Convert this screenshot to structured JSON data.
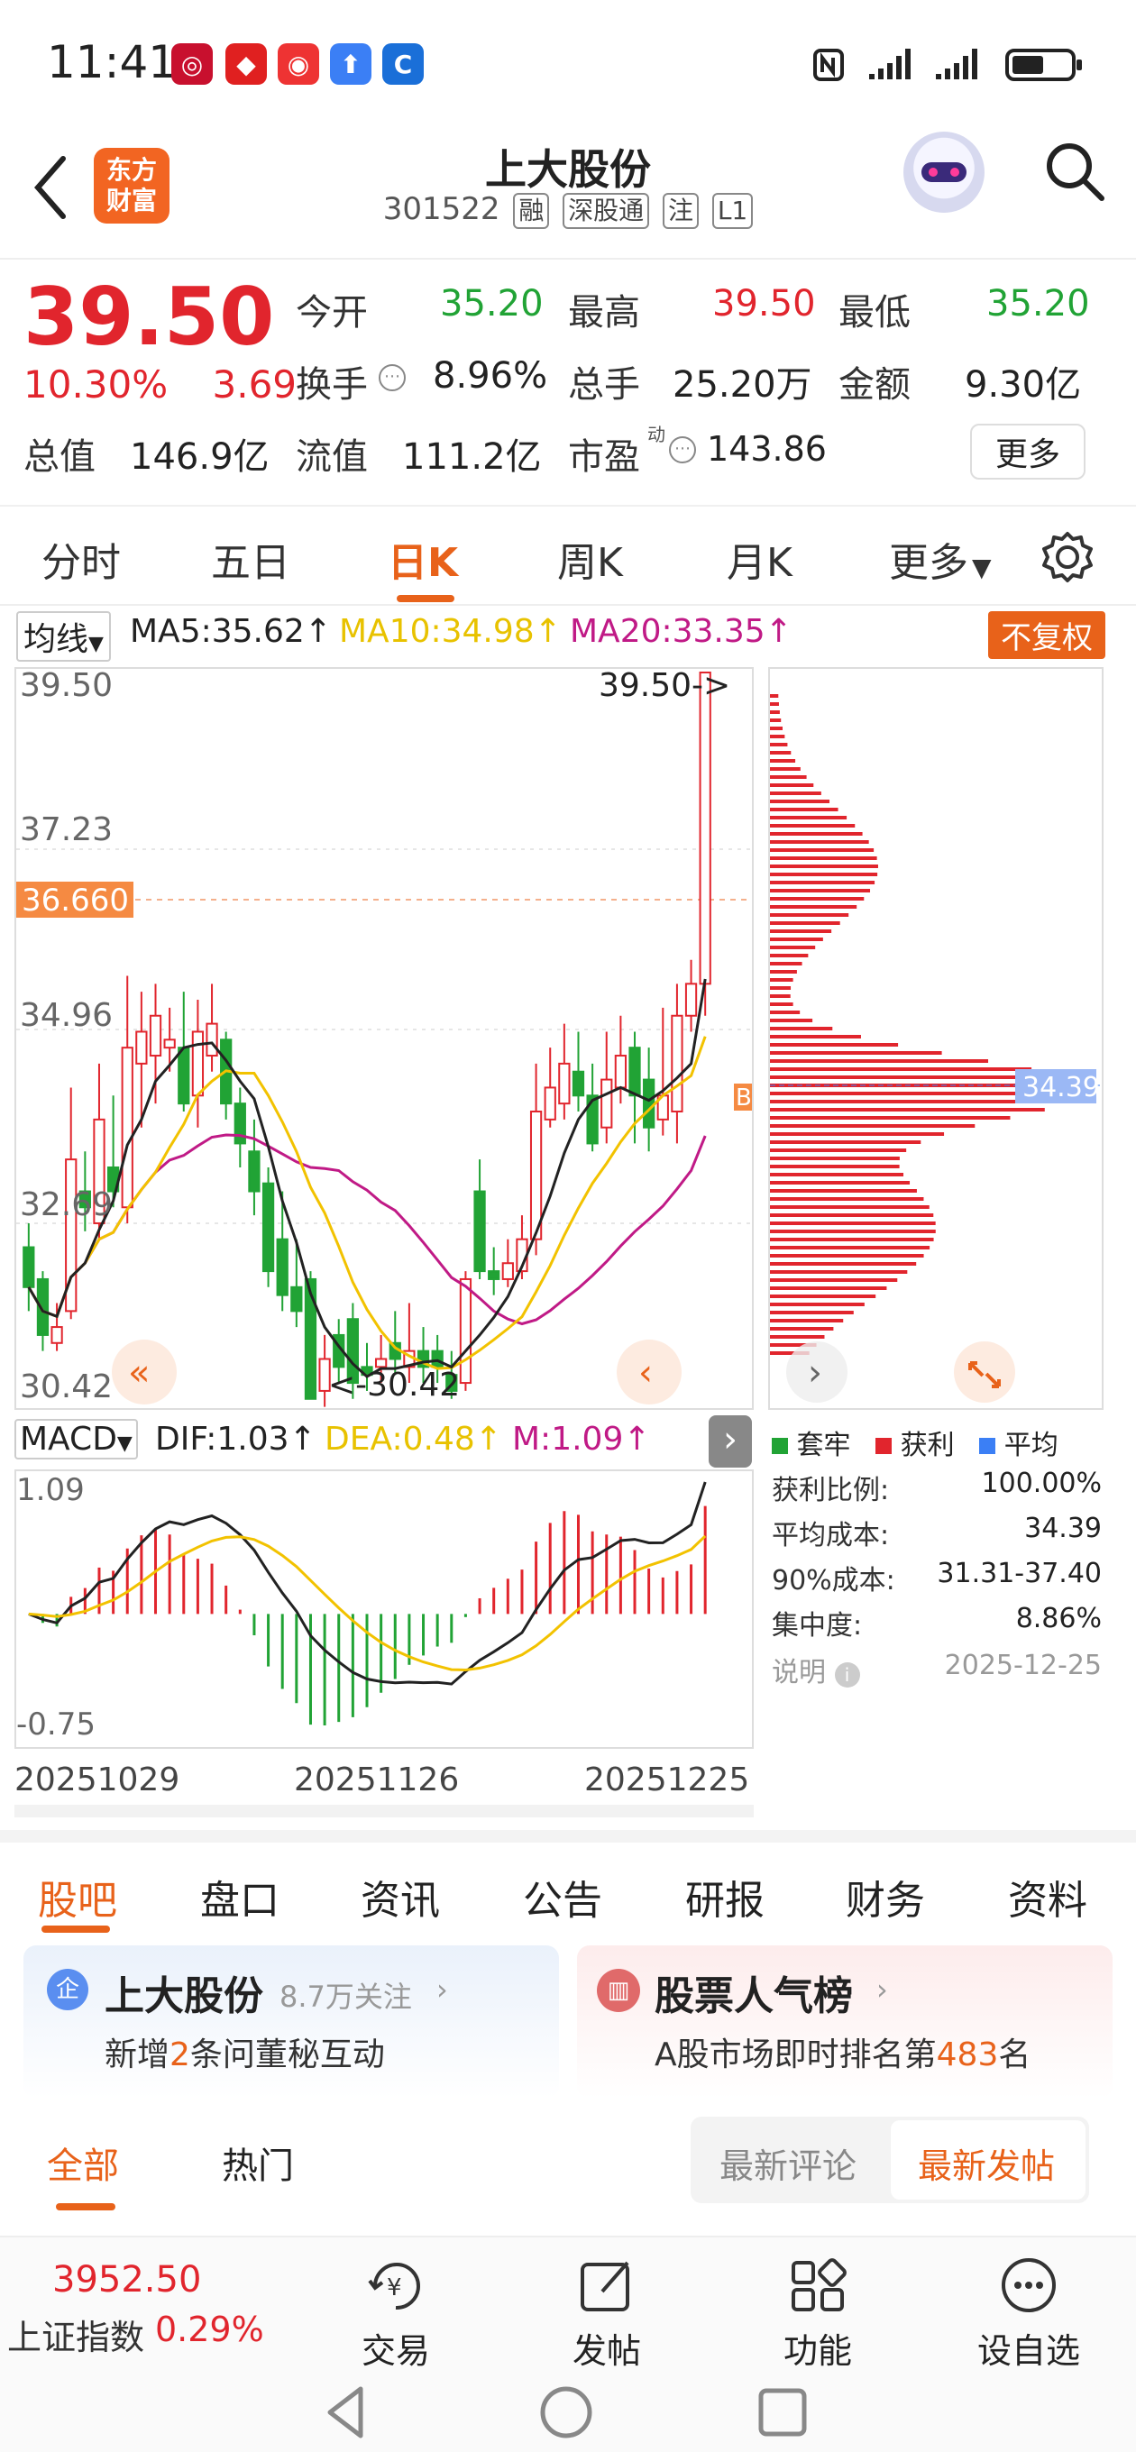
{
  "status": {
    "time": "11:41"
  },
  "header": {
    "title": "上大股份",
    "code": "301522",
    "tags": [
      "融",
      "深股通",
      "注",
      "L1"
    ],
    "logo_line1": "东方",
    "logo_line2": "财富"
  },
  "quote": {
    "price": "39.50",
    "change_pct": "10.30%",
    "change": "3.69",
    "open_label": "今开",
    "open": "35.20",
    "high_label": "最高",
    "high": "39.50",
    "low_label": "最低",
    "low": "35.20",
    "turnover_label": "换手",
    "turnover": "8.96%",
    "volume_label": "总手",
    "volume": "25.20万",
    "amount_label": "金额",
    "amount": "9.30亿",
    "mktcap_label": "总值",
    "mktcap": "146.9亿",
    "float_label": "流值",
    "float": "111.2亿",
    "pe_label": "市盈",
    "pe_sup": "动",
    "pe": "143.86",
    "more": "更多"
  },
  "tabs": [
    "分时",
    "五日",
    "日K",
    "周K",
    "月K",
    "更多"
  ],
  "ma": {
    "label": "均线",
    "ma5": "MA5:35.62↑",
    "ma10": "MA10:34.98↑",
    "ma20": "MA20:33.35↑",
    "fq": "不复权"
  },
  "kline": {
    "y_labels": [
      "39.50",
      "37.23",
      "34.96",
      "32.69",
      "30.42"
    ],
    "current_price_tag": "36.660",
    "max_tag": "39.50->",
    "min_tag": "<-30.42",
    "b_tag": "B"
  },
  "chip": {
    "avg_tag": "34.39"
  },
  "macd": {
    "label": "MACD",
    "dif": "DIF:1.03↑",
    "dea": "DEA:0.48↑",
    "m": "M:1.09↑",
    "top": "1.09",
    "bottom": "-0.75"
  },
  "dates": [
    "20251029",
    "20251126",
    "20251225"
  ],
  "chip_stats": {
    "legend": [
      "套牢",
      "获利",
      "平均"
    ],
    "rows": [
      {
        "label": "获利比例:",
        "value": "100.00%"
      },
      {
        "label": "平均成本:",
        "value": "34.39"
      },
      {
        "label": "90%成本:",
        "value": "31.31-37.40"
      },
      {
        "label": "集中度:",
        "value": "8.86%"
      }
    ],
    "note_label": "说明",
    "note_date": "2025-12-25"
  },
  "bottom_tabs": [
    "股吧",
    "盘口",
    "资讯",
    "公告",
    "研报",
    "财务",
    "资料"
  ],
  "card_left": {
    "badge": "企",
    "title": "上大股份",
    "follow": "8.7万关注",
    "line_pre": "新增",
    "line_num": "2",
    "line_post": "条问董秘互动"
  },
  "card_right": {
    "title": "股票人气榜",
    "line_pre": "A股市场即时排名第",
    "line_num": "483",
    "line_post": "名"
  },
  "sub_tabs": [
    "全部",
    "热门"
  ],
  "sort": [
    "最新评论",
    "最新发帖"
  ],
  "index": {
    "value": "3952.50",
    "name": "上证指数",
    "pct": "0.29%"
  },
  "nav": [
    "交易",
    "发帖",
    "功能",
    "设自选"
  ],
  "colors": {
    "up": "#e1252d",
    "down": "#21a335",
    "accent": "#e8621a",
    "ma5": "#222222",
    "ma10": "#f2c200",
    "ma20": "#c01a86"
  },
  "chart_data": {
    "type": "candlestick",
    "ylim": [
      30.42,
      39.5
    ],
    "candles": [
      {
        "o": 32.3,
        "c": 31.8,
        "h": 32.6,
        "l": 31.5
      },
      {
        "o": 31.9,
        "c": 31.2,
        "h": 32.0,
        "l": 31.0
      },
      {
        "o": 31.1,
        "c": 31.3,
        "h": 31.6,
        "l": 31.0
      },
      {
        "o": 31.5,
        "c": 33.4,
        "h": 34.3,
        "l": 31.4
      },
      {
        "o": 33.0,
        "c": 32.8,
        "h": 33.5,
        "l": 32.5
      },
      {
        "o": 32.6,
        "c": 33.9,
        "h": 34.6,
        "l": 32.4
      },
      {
        "o": 33.3,
        "c": 33.0,
        "h": 34.2,
        "l": 32.8
      },
      {
        "o": 32.8,
        "c": 34.8,
        "h": 35.7,
        "l": 32.6
      },
      {
        "o": 34.6,
        "c": 35.0,
        "h": 35.5,
        "l": 33.8
      },
      {
        "o": 34.7,
        "c": 35.2,
        "h": 35.6,
        "l": 34.1
      },
      {
        "o": 34.8,
        "c": 34.9,
        "h": 35.3,
        "l": 34.5
      },
      {
        "o": 34.8,
        "c": 34.1,
        "h": 35.5,
        "l": 34.0
      },
      {
        "o": 34.2,
        "c": 35.0,
        "h": 35.4,
        "l": 33.8
      },
      {
        "o": 34.7,
        "c": 35.1,
        "h": 35.6,
        "l": 34.5
      },
      {
        "o": 34.9,
        "c": 34.1,
        "h": 35.0,
        "l": 33.9
      },
      {
        "o": 34.1,
        "c": 33.6,
        "h": 34.3,
        "l": 33.3
      },
      {
        "o": 33.5,
        "c": 33.0,
        "h": 33.9,
        "l": 32.7
      },
      {
        "o": 33.1,
        "c": 32.0,
        "h": 33.3,
        "l": 31.8
      },
      {
        "o": 32.4,
        "c": 31.7,
        "h": 33.0,
        "l": 31.5
      },
      {
        "o": 31.8,
        "c": 31.5,
        "h": 32.4,
        "l": 31.3
      },
      {
        "o": 31.9,
        "c": 30.4,
        "h": 32.0,
        "l": 30.42
      },
      {
        "o": 30.5,
        "c": 30.9,
        "h": 31.2,
        "l": 30.3
      },
      {
        "o": 31.2,
        "c": 30.8,
        "h": 31.4,
        "l": 30.6
      },
      {
        "o": 31.4,
        "c": 30.6,
        "h": 31.6,
        "l": 30.4
      },
      {
        "o": 30.8,
        "c": 30.7,
        "h": 31.1,
        "l": 30.5
      },
      {
        "o": 30.8,
        "c": 30.9,
        "h": 31.2,
        "l": 30.6
      },
      {
        "o": 31.1,
        "c": 30.9,
        "h": 31.5,
        "l": 30.7
      },
      {
        "o": 30.8,
        "c": 31.0,
        "h": 31.6,
        "l": 30.6
      },
      {
        "o": 31.0,
        "c": 30.8,
        "h": 31.3,
        "l": 30.6
      },
      {
        "o": 31.0,
        "c": 30.8,
        "h": 31.2,
        "l": 30.6
      },
      {
        "o": 30.7,
        "c": 30.5,
        "h": 31.0,
        "l": 30.4
      },
      {
        "o": 30.6,
        "c": 31.9,
        "h": 32.0,
        "l": 30.5
      },
      {
        "o": 33.0,
        "c": 32.0,
        "h": 33.4,
        "l": 31.9
      },
      {
        "o": 32.0,
        "c": 31.9,
        "h": 32.3,
        "l": 31.7
      },
      {
        "o": 31.9,
        "c": 32.1,
        "h": 32.4,
        "l": 31.8
      },
      {
        "o": 32.0,
        "c": 32.4,
        "h": 32.7,
        "l": 31.9
      },
      {
        "o": 32.4,
        "c": 34.0,
        "h": 34.6,
        "l": 32.2
      },
      {
        "o": 33.9,
        "c": 34.3,
        "h": 34.8,
        "l": 33.8
      },
      {
        "o": 34.1,
        "c": 34.6,
        "h": 35.1,
        "l": 33.9
      },
      {
        "o": 34.5,
        "c": 34.2,
        "h": 35.0,
        "l": 34.0
      },
      {
        "o": 34.2,
        "c": 33.6,
        "h": 34.6,
        "l": 33.5
      },
      {
        "o": 33.8,
        "c": 34.4,
        "h": 35.0,
        "l": 33.6
      },
      {
        "o": 34.3,
        "c": 34.7,
        "h": 35.2,
        "l": 34.1
      },
      {
        "o": 34.8,
        "c": 34.2,
        "h": 35.0,
        "l": 33.6
      },
      {
        "o": 34.4,
        "c": 33.8,
        "h": 34.8,
        "l": 33.5
      },
      {
        "o": 33.9,
        "c": 34.2,
        "h": 35.3,
        "l": 33.7
      },
      {
        "o": 34.0,
        "c": 35.2,
        "h": 35.6,
        "l": 33.6
      },
      {
        "o": 35.2,
        "c": 35.6,
        "h": 35.9,
        "l": 35.0
      },
      {
        "o": 35.6,
        "c": 39.5,
        "h": 39.5,
        "l": 35.2
      }
    ]
  }
}
